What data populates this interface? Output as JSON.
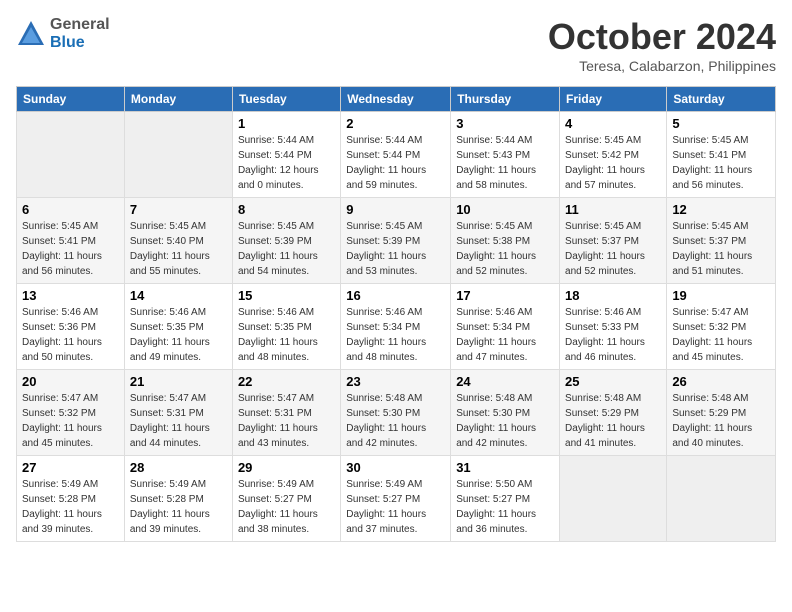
{
  "header": {
    "logo": {
      "general": "General",
      "blue": "Blue"
    },
    "title": "October 2024",
    "location": "Teresa, Calabarzon, Philippines"
  },
  "days_of_week": [
    "Sunday",
    "Monday",
    "Tuesday",
    "Wednesday",
    "Thursday",
    "Friday",
    "Saturday"
  ],
  "weeks": [
    [
      null,
      null,
      {
        "day": "1",
        "sunrise": "Sunrise: 5:44 AM",
        "sunset": "Sunset: 5:44 PM",
        "daylight": "Daylight: 12 hours and 0 minutes."
      },
      {
        "day": "2",
        "sunrise": "Sunrise: 5:44 AM",
        "sunset": "Sunset: 5:44 PM",
        "daylight": "Daylight: 11 hours and 59 minutes."
      },
      {
        "day": "3",
        "sunrise": "Sunrise: 5:44 AM",
        "sunset": "Sunset: 5:43 PM",
        "daylight": "Daylight: 11 hours and 58 minutes."
      },
      {
        "day": "4",
        "sunrise": "Sunrise: 5:45 AM",
        "sunset": "Sunset: 5:42 PM",
        "daylight": "Daylight: 11 hours and 57 minutes."
      },
      {
        "day": "5",
        "sunrise": "Sunrise: 5:45 AM",
        "sunset": "Sunset: 5:41 PM",
        "daylight": "Daylight: 11 hours and 56 minutes."
      }
    ],
    [
      {
        "day": "6",
        "sunrise": "Sunrise: 5:45 AM",
        "sunset": "Sunset: 5:41 PM",
        "daylight": "Daylight: 11 hours and 56 minutes."
      },
      {
        "day": "7",
        "sunrise": "Sunrise: 5:45 AM",
        "sunset": "Sunset: 5:40 PM",
        "daylight": "Daylight: 11 hours and 55 minutes."
      },
      {
        "day": "8",
        "sunrise": "Sunrise: 5:45 AM",
        "sunset": "Sunset: 5:39 PM",
        "daylight": "Daylight: 11 hours and 54 minutes."
      },
      {
        "day": "9",
        "sunrise": "Sunrise: 5:45 AM",
        "sunset": "Sunset: 5:39 PM",
        "daylight": "Daylight: 11 hours and 53 minutes."
      },
      {
        "day": "10",
        "sunrise": "Sunrise: 5:45 AM",
        "sunset": "Sunset: 5:38 PM",
        "daylight": "Daylight: 11 hours and 52 minutes."
      },
      {
        "day": "11",
        "sunrise": "Sunrise: 5:45 AM",
        "sunset": "Sunset: 5:37 PM",
        "daylight": "Daylight: 11 hours and 52 minutes."
      },
      {
        "day": "12",
        "sunrise": "Sunrise: 5:45 AM",
        "sunset": "Sunset: 5:37 PM",
        "daylight": "Daylight: 11 hours and 51 minutes."
      }
    ],
    [
      {
        "day": "13",
        "sunrise": "Sunrise: 5:46 AM",
        "sunset": "Sunset: 5:36 PM",
        "daylight": "Daylight: 11 hours and 50 minutes."
      },
      {
        "day": "14",
        "sunrise": "Sunrise: 5:46 AM",
        "sunset": "Sunset: 5:35 PM",
        "daylight": "Daylight: 11 hours and 49 minutes."
      },
      {
        "day": "15",
        "sunrise": "Sunrise: 5:46 AM",
        "sunset": "Sunset: 5:35 PM",
        "daylight": "Daylight: 11 hours and 48 minutes."
      },
      {
        "day": "16",
        "sunrise": "Sunrise: 5:46 AM",
        "sunset": "Sunset: 5:34 PM",
        "daylight": "Daylight: 11 hours and 48 minutes."
      },
      {
        "day": "17",
        "sunrise": "Sunrise: 5:46 AM",
        "sunset": "Sunset: 5:34 PM",
        "daylight": "Daylight: 11 hours and 47 minutes."
      },
      {
        "day": "18",
        "sunrise": "Sunrise: 5:46 AM",
        "sunset": "Sunset: 5:33 PM",
        "daylight": "Daylight: 11 hours and 46 minutes."
      },
      {
        "day": "19",
        "sunrise": "Sunrise: 5:47 AM",
        "sunset": "Sunset: 5:32 PM",
        "daylight": "Daylight: 11 hours and 45 minutes."
      }
    ],
    [
      {
        "day": "20",
        "sunrise": "Sunrise: 5:47 AM",
        "sunset": "Sunset: 5:32 PM",
        "daylight": "Daylight: 11 hours and 45 minutes."
      },
      {
        "day": "21",
        "sunrise": "Sunrise: 5:47 AM",
        "sunset": "Sunset: 5:31 PM",
        "daylight": "Daylight: 11 hours and 44 minutes."
      },
      {
        "day": "22",
        "sunrise": "Sunrise: 5:47 AM",
        "sunset": "Sunset: 5:31 PM",
        "daylight": "Daylight: 11 hours and 43 minutes."
      },
      {
        "day": "23",
        "sunrise": "Sunrise: 5:48 AM",
        "sunset": "Sunset: 5:30 PM",
        "daylight": "Daylight: 11 hours and 42 minutes."
      },
      {
        "day": "24",
        "sunrise": "Sunrise: 5:48 AM",
        "sunset": "Sunset: 5:30 PM",
        "daylight": "Daylight: 11 hours and 42 minutes."
      },
      {
        "day": "25",
        "sunrise": "Sunrise: 5:48 AM",
        "sunset": "Sunset: 5:29 PM",
        "daylight": "Daylight: 11 hours and 41 minutes."
      },
      {
        "day": "26",
        "sunrise": "Sunrise: 5:48 AM",
        "sunset": "Sunset: 5:29 PM",
        "daylight": "Daylight: 11 hours and 40 minutes."
      }
    ],
    [
      {
        "day": "27",
        "sunrise": "Sunrise: 5:49 AM",
        "sunset": "Sunset: 5:28 PM",
        "daylight": "Daylight: 11 hours and 39 minutes."
      },
      {
        "day": "28",
        "sunrise": "Sunrise: 5:49 AM",
        "sunset": "Sunset: 5:28 PM",
        "daylight": "Daylight: 11 hours and 39 minutes."
      },
      {
        "day": "29",
        "sunrise": "Sunrise: 5:49 AM",
        "sunset": "Sunset: 5:27 PM",
        "daylight": "Daylight: 11 hours and 38 minutes."
      },
      {
        "day": "30",
        "sunrise": "Sunrise: 5:49 AM",
        "sunset": "Sunset: 5:27 PM",
        "daylight": "Daylight: 11 hours and 37 minutes."
      },
      {
        "day": "31",
        "sunrise": "Sunrise: 5:50 AM",
        "sunset": "Sunset: 5:27 PM",
        "daylight": "Daylight: 11 hours and 36 minutes."
      },
      null,
      null
    ]
  ]
}
